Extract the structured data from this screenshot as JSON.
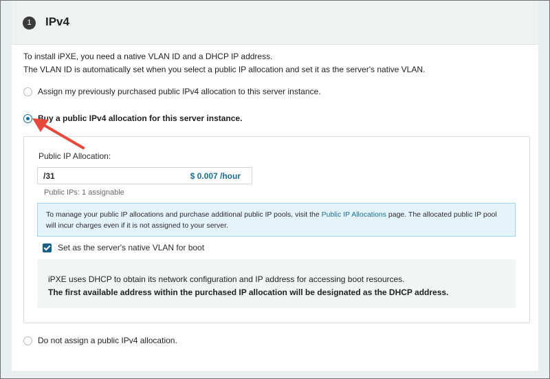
{
  "section": {
    "step_number": "1",
    "title": "IPv4"
  },
  "intro": {
    "line1": "To install iPXE, you need a native VLAN ID and a DHCP IP address.",
    "line2": "The VLAN ID is automatically set when you select a public IP allocation and set it as the server's native VLAN."
  },
  "options": {
    "assign_previous": "Assign my previously purchased public IPv4 allocation to this server instance.",
    "buy_new": "Buy a public IPv4 allocation for this server instance.",
    "no_assign": "Do not assign a public IPv4 allocation.",
    "selected": "buy_new"
  },
  "allocation": {
    "label": "Public IP Allocation:",
    "value": "/31",
    "price": "$ 0.007 /hour",
    "hint": "Public IPs: 1 assignable"
  },
  "info_banner": {
    "text_before": "To manage your public IP allocations and purchase additional public IP pools, visit the ",
    "link_text": "Public IP Allocations",
    "text_after": " page. The allocated public IP pool will incur charges even if it is not assigned to your server."
  },
  "native_vlan": {
    "label": "Set as the server's native VLAN for boot",
    "checked": true
  },
  "note": {
    "line1": "iPXE uses DHCP to obtain its network configuration and IP address for accessing boot resources.",
    "line2": "The first available address within the purchased IP allocation will be designated as the DHCP address."
  },
  "icons": {
    "annotation": "red-arrow-icon"
  },
  "colors": {
    "accent": "#0f6f95",
    "price": "#1b6c93",
    "checkbox": "#1a5f86",
    "banner_bg": "#e5f3fa",
    "banner_border": "#9fd3eb",
    "arrow": "#e8473b"
  }
}
